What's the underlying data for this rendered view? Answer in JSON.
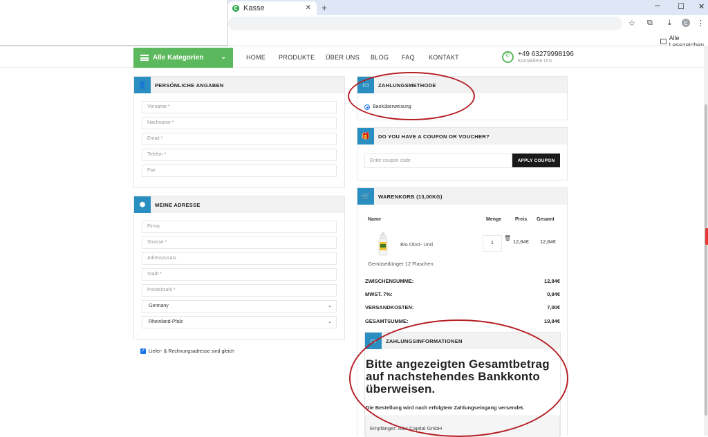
{
  "browser": {
    "tab_title": "Kasse",
    "tab_favicon_letter": "E",
    "new_tab": "+",
    "win_min": "─",
    "win_max": "☐",
    "win_close": "✕",
    "bookmarks_label": "Alle Lesezeichen",
    "profile_letter": "E"
  },
  "nav": {
    "categories": "Alle Kategorien",
    "links": [
      "HOME",
      "PRODUKTE",
      "ÜBER UNS",
      "BLOG",
      "FAQ",
      "KONTAKT"
    ],
    "phone": "+49 63279998196",
    "phone_sub": "Kontaktiere Uns"
  },
  "personal": {
    "title": "PERSÖNLICHE ANGABEN",
    "fields": [
      "Vorname *",
      "Nachname *",
      "Email *",
      "Telefon *",
      "Fax"
    ]
  },
  "address": {
    "title": "MEINE ADRESSE",
    "fields": [
      "Firma",
      "Strasse *",
      "Adresszusatz",
      "Stadt *",
      "Postleitzahl *"
    ],
    "country": "Germany",
    "state": "Rheinland-Pfalz",
    "same_address": "Liefer- & Rechnungsadresse sind gleich"
  },
  "payment": {
    "title": "ZAHLUNGSMETHODE",
    "option": "Banküberweisung"
  },
  "coupon": {
    "title": "DO YOU HAVE A COUPON OR VOUCHER?",
    "placeholder": "Enter coupon code",
    "button": "APPLY COUPON"
  },
  "cart": {
    "title": "WARENKORB (13,00KG)",
    "headers": {
      "name": "Name",
      "qty": "Menge",
      "price": "Preis",
      "total": "Gesamt"
    },
    "item": {
      "name_line1": "Bio Obst- Und",
      "name_line2": "Gemüsedünger 12 Flaschen",
      "qty": "1",
      "price": "12,84€",
      "total": "12,84€"
    },
    "summary": [
      {
        "label": "ZWISCHENSUMME:",
        "value": "12,84€"
      },
      {
        "label": "MWST. 7%:",
        "value": "0,84€"
      },
      {
        "label": "VERSANDKOSTEN:",
        "value": "7,00€"
      },
      {
        "label": "GESAMTSUMME:",
        "value": "19,84€"
      }
    ]
  },
  "payinfo": {
    "title": "ZAHLUNGSINFORMATIONEN",
    "big_line1": "Bitte angezeigten Gesamtbetrag",
    "big_line2": "auf nachstehendes Bankkonto",
    "big_line3": "überweisen.",
    "note": "Die Bestellung wird nach erfolgtem Zahlungseingang versendet.",
    "recipient": "Empfänger: Alex Capital GmbH"
  },
  "colors": {
    "accent_green": "#5cb85c",
    "icon_blue": "#2a8fc0",
    "annotation_red": "#b51f24"
  }
}
